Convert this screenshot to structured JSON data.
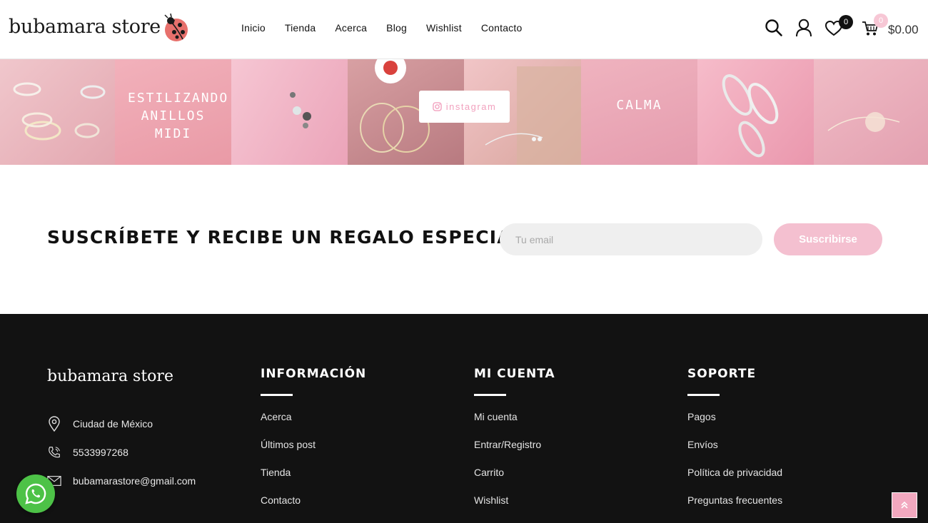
{
  "header": {
    "brand": "bubamara store",
    "nav": [
      "Inicio",
      "Tienda",
      "Acerca",
      "Blog",
      "Wishlist",
      "Contacto"
    ],
    "wishlist_count": "0",
    "cart_count": "0",
    "cart_total": "$0.00",
    "icons": [
      "search-icon",
      "user-icon",
      "heart-icon",
      "cart-icon"
    ]
  },
  "instagram": {
    "tiles": [
      {
        "text": "",
        "color": "#e9b7bf"
      },
      {
        "text": "ESTILIZANDO ANILLOS MIDI",
        "color": "#eda7b2"
      },
      {
        "text": "",
        "color": "#f1b6c6"
      },
      {
        "text": "",
        "color": "#c9949a"
      },
      {
        "text": "",
        "color": "#e8b9b8"
      },
      {
        "text": "CALMA",
        "color": "#e8a3b4"
      },
      {
        "text": "",
        "color": "#f0a9bc"
      },
      {
        "text": "",
        "color": "#e7a6b2"
      }
    ],
    "button_label": "instagram"
  },
  "newsletter": {
    "title": "SUSCRÍBETE Y RECIBE UN REGALO ESPECIAL",
    "placeholder": "Tu email",
    "button": "Suscribirse"
  },
  "footer": {
    "brand": "bubamara store",
    "contact": {
      "location": "Ciudad de México",
      "phone": "5533997268",
      "email": "bubamarastore@gmail.com"
    },
    "columns": [
      {
        "title": "INFORMACIÓN",
        "links": [
          "Acerca",
          "Últimos post",
          "Tienda",
          "Contacto"
        ]
      },
      {
        "title": "MI CUENTA",
        "links": [
          "Mi cuenta",
          "Entrar/Registro",
          "Carrito",
          "Wishlist"
        ]
      },
      {
        "title": "SOPORTE",
        "links": [
          "Pagos",
          "Envíos",
          "Política de privacidad",
          "Preguntas frecuentes"
        ]
      }
    ]
  },
  "colors": {
    "accent_pink": "#f4c0d0",
    "footer_bg": "#121212",
    "whatsapp_green": "#4dc247"
  }
}
